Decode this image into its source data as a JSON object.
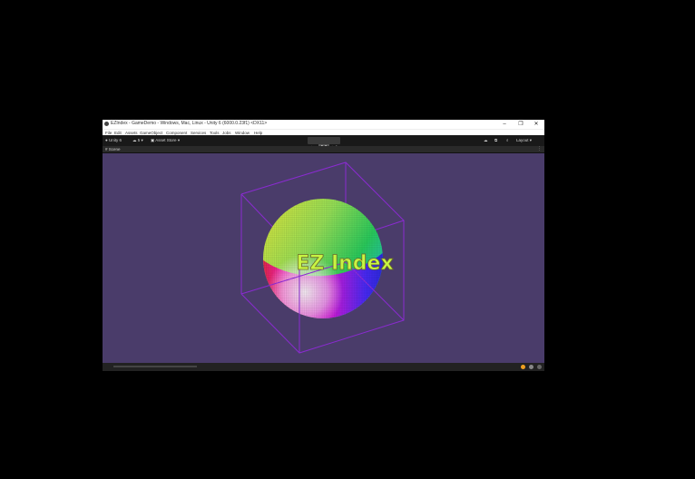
{
  "window": {
    "title": "EZIndex - GameDemo - Windows, Mac, Linux - Unity 6 (6000.0.23f1) <DX11>",
    "controls": {
      "minimize": "–",
      "maximize": "❐",
      "close": "✕"
    }
  },
  "menu": [
    "File",
    "Edit",
    "Assets",
    "GameObject",
    "Component",
    "Services",
    "Tools",
    "Jobs",
    "Window",
    "Help"
  ],
  "toolbar": {
    "account": "Unity 6",
    "cloud": "5",
    "asset_store": "Asset Store",
    "play": "▶",
    "pause": "❚❚",
    "step": "▶|",
    "layout": "Layout"
  },
  "scene": {
    "tab_label": "Scene"
  },
  "overlay": {
    "text": "EZ Index",
    "text_color": "#c8f542"
  },
  "colors": {
    "viewport_bg": "#4a3c6a",
    "cube_wire": "#8a2bd0"
  }
}
